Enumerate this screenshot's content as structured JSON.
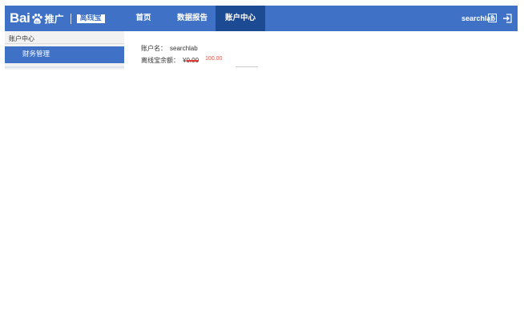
{
  "header": {
    "logo": {
      "bai": "Bai",
      "du": "du",
      "tuiguang": "推广",
      "badge": "离线宝"
    },
    "nav": [
      {
        "label": "首页"
      },
      {
        "label": "数据报告"
      },
      {
        "label": "账户中心"
      }
    ],
    "user": "searchlab",
    "help_label": "?"
  },
  "sidebar": {
    "title": "账户中心",
    "items": [
      {
        "label": "财务管理"
      }
    ]
  },
  "account": {
    "name_label": "账户名：",
    "name_value": "searchlab",
    "balance_label": "离线宝余额：",
    "currency": "¥",
    "balance_old": "0.00",
    "balance_new": "100.00"
  },
  "colors": {
    "header_bg": "#3f72c6",
    "nav_active_bg": "#1c4b93",
    "sidebar_bg": "#f2f2f2",
    "sidebar_active_bg": "#3f72c6",
    "balance_new": "#e35a4e"
  }
}
